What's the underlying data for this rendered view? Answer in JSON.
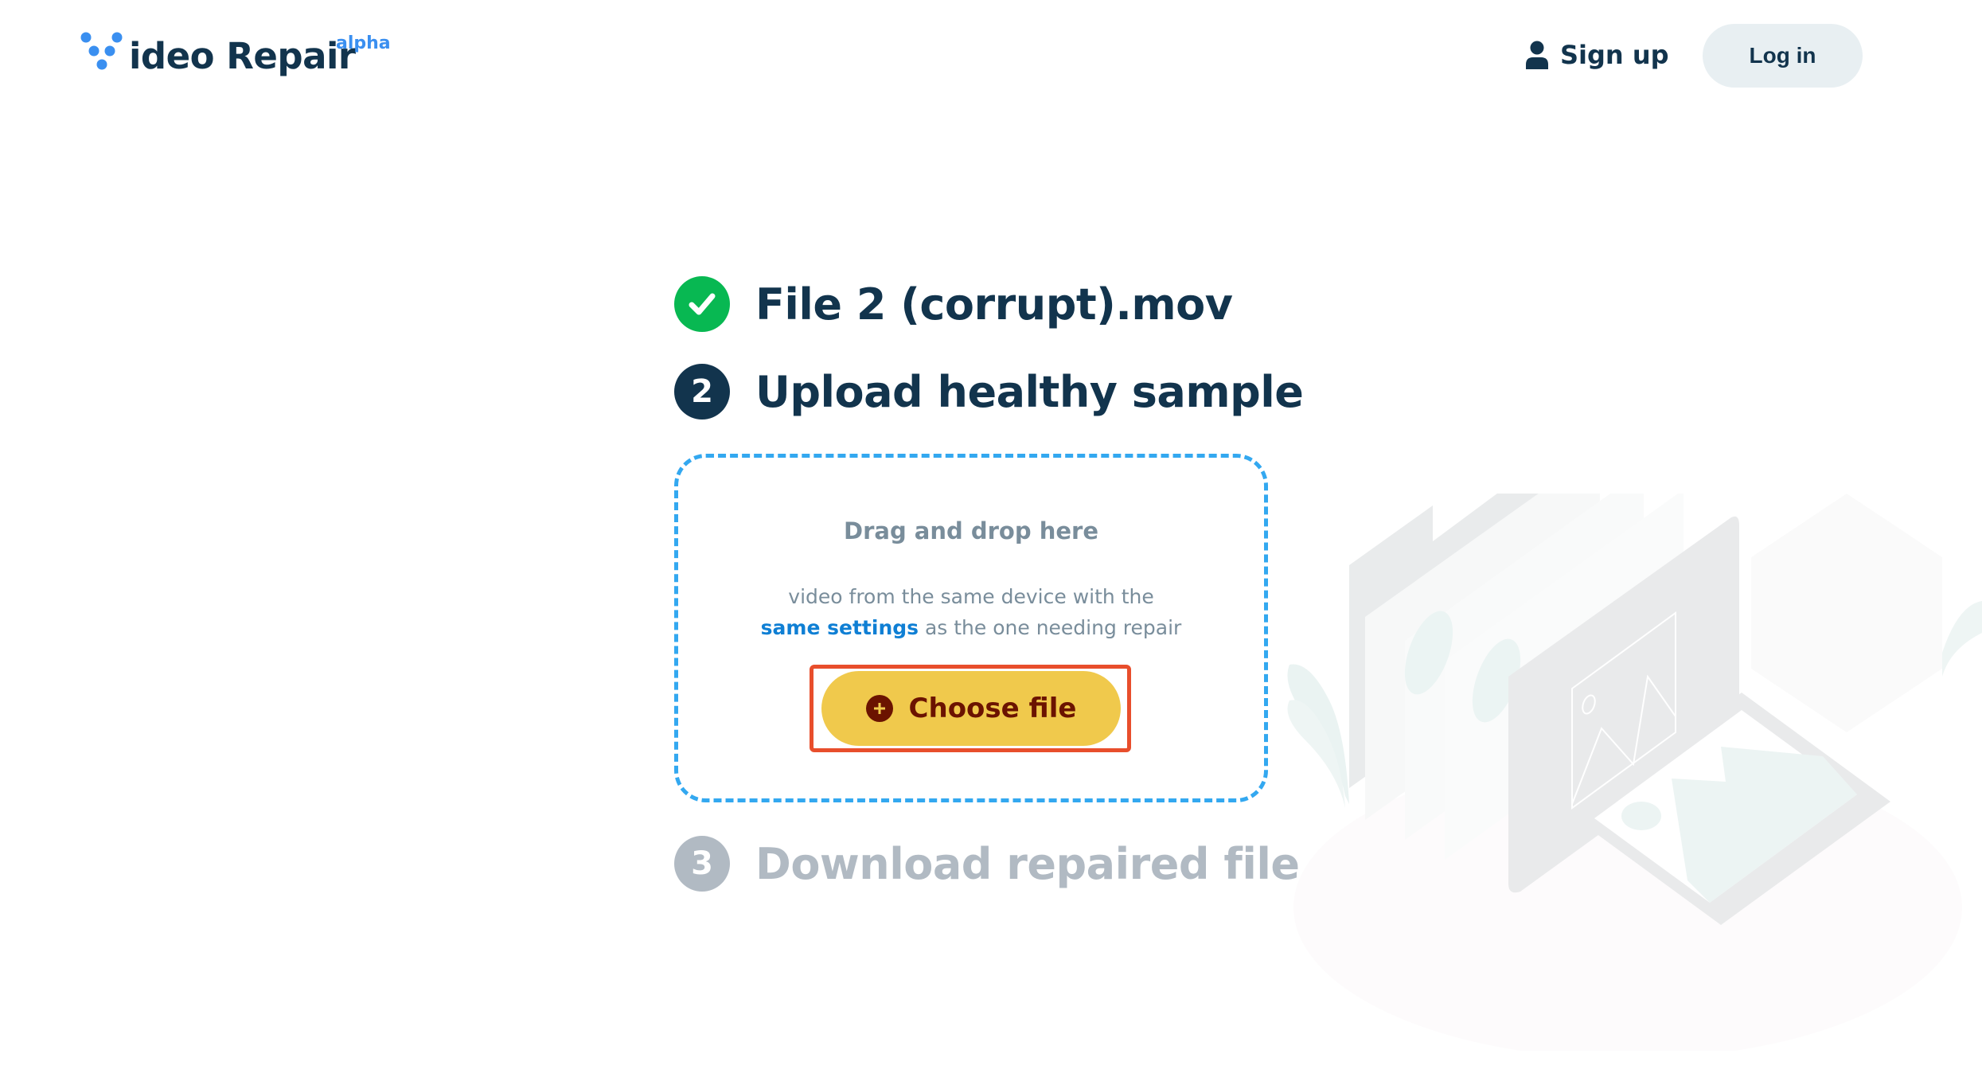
{
  "header": {
    "logo_text": "ideo Repair",
    "logo_badge": "alpha",
    "signup_label": "Sign up",
    "login_label": "Log in"
  },
  "steps": [
    {
      "number": "✓",
      "title": "File 2 (corrupt).mov",
      "status": "done"
    },
    {
      "number": "2",
      "title": "Upload healthy sample",
      "status": "active"
    },
    {
      "number": "3",
      "title": "Download repaired file",
      "status": "pending"
    }
  ],
  "dropzone": {
    "title": "Drag and drop here",
    "desc_line1": "video from the same device with the",
    "desc_link": "same settings",
    "desc_line2_rest": " as the one needing repair",
    "choose_label": "Choose file"
  },
  "colors": {
    "brand_dark": "#12344d",
    "brand_blue": "#3a8ff0",
    "success": "#08b852",
    "pending": "#b1bac3",
    "dropzone_border": "#33a8f0",
    "button_yellow": "#f0c94c",
    "button_text": "#6b1300",
    "highlight": "#e84e2c"
  }
}
